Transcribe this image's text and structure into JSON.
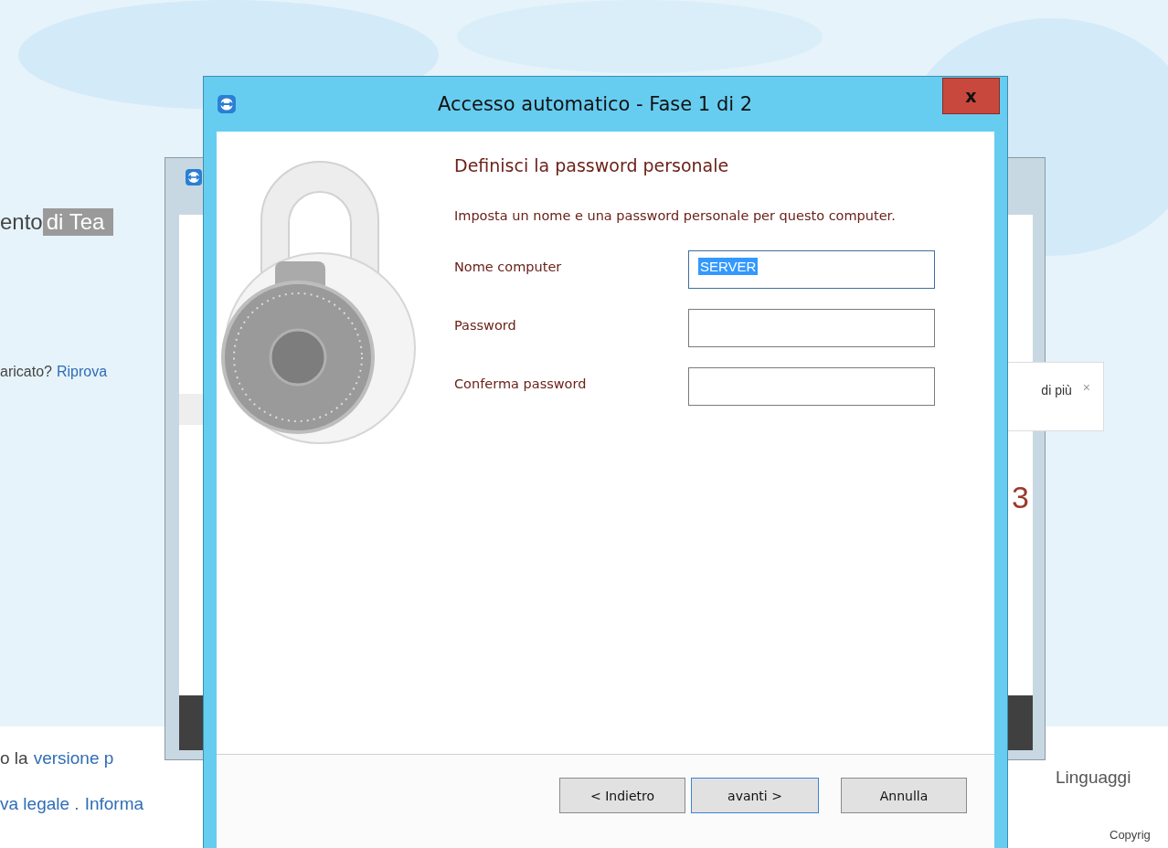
{
  "background_page": {
    "heading_start": "ento",
    "heading_highlight": "di Tea",
    "retry_prompt": "aricato?",
    "retry_link": "Riprova",
    "notice": {
      "text": "di più",
      "close": "×"
    },
    "footer_lines": [
      [
        {
          "kind": "text",
          "text": "o la"
        },
        {
          "kind": "link",
          "text": "versione p"
        }
      ],
      [
        {
          "kind": "link",
          "text": "va legale ."
        },
        {
          "kind": "link",
          "text": "Informa"
        }
      ]
    ],
    "language": "Linguaggi",
    "copyright": "Copyrig"
  },
  "back_window": {
    "big_char": "3"
  },
  "dialog": {
    "title": "Accesso automatico - Fase 1 di 2",
    "close": "x",
    "heading": "Definisci la password personale",
    "description": "Imposta un nome e una password personale per questo computer.",
    "fields": [
      {
        "label": "Nome computer",
        "value": "SERVER",
        "focused": true
      },
      {
        "label": "Password",
        "focused": false
      },
      {
        "label": "Conferma password",
        "focused": false
      }
    ],
    "buttons": [
      {
        "label": "< Indietro",
        "default": false
      },
      {
        "label": "avanti >",
        "default": true
      },
      {
        "label": "Annulla",
        "default": false
      }
    ]
  }
}
